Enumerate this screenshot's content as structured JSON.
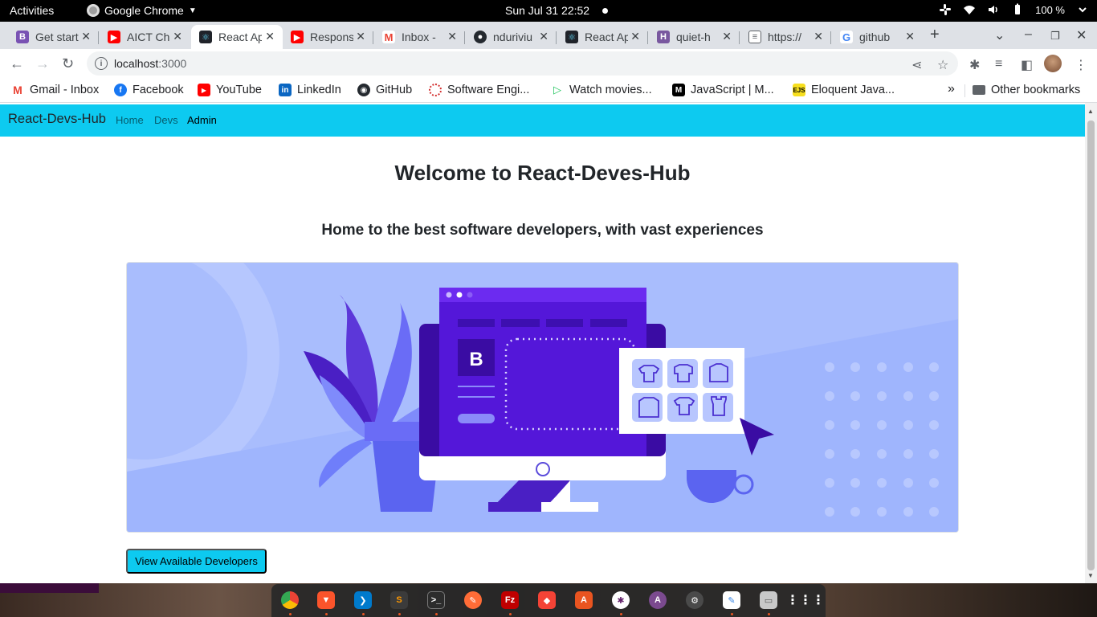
{
  "system": {
    "activities": "Activities",
    "app_name": "Google Chrome",
    "clock": "Sun Jul 31  22:52",
    "battery": "100 %"
  },
  "tabs": [
    {
      "title": "Get started",
      "favicon": "bootstrap-icon",
      "color": "#7952b3"
    },
    {
      "title": "AICT Chan",
      "favicon": "youtube-icon",
      "color": "#ff0000"
    },
    {
      "title": "React App",
      "favicon": "react-icon",
      "color": "#20232a",
      "active": true
    },
    {
      "title": "Responsive",
      "favicon": "youtube-icon",
      "color": "#ff0000"
    },
    {
      "title": "Inbox - ",
      "favicon": "gmail-icon",
      "color": "#ea4335"
    },
    {
      "title": "nduriviu",
      "favicon": "github-icon",
      "color": "#24292f"
    },
    {
      "title": "React App",
      "favicon": "react-icon",
      "color": "#20232a"
    },
    {
      "title": "quiet-h",
      "favicon": "heroku-icon",
      "color": "#79589f"
    },
    {
      "title": "https://",
      "favicon": "page-icon",
      "color": "#5f6368"
    },
    {
      "title": "github",
      "favicon": "google-icon",
      "color": "#4285f4"
    }
  ],
  "omnibox": {
    "host": "localhost",
    "port": ":3000"
  },
  "bookmarks": [
    {
      "label": "Gmail - Inbox",
      "icon": "gmail-icon",
      "color": "#ea4335"
    },
    {
      "label": "Facebook",
      "icon": "facebook-icon",
      "color": "#1877f2"
    },
    {
      "label": "YouTube",
      "icon": "youtube-icon",
      "color": "#ff0000"
    },
    {
      "label": "LinkedIn",
      "icon": "linkedin-icon",
      "color": "#0a66c2"
    },
    {
      "label": "GitHub",
      "icon": "github-icon",
      "color": "#24292f"
    },
    {
      "label": "Software Engi...",
      "icon": "circle-icon",
      "color": "#d32f2f"
    },
    {
      "label": "Watch movies...",
      "icon": "play-icon",
      "color": "#22c55e"
    },
    {
      "label": "JavaScript | M...",
      "icon": "mdn-icon",
      "color": "#000000"
    },
    {
      "label": "Eloquent Java...",
      "icon": "ejs-icon",
      "color": "#f7df1e"
    }
  ],
  "bookmarks_overflow": "»",
  "other_bookmarks": "Other bookmarks",
  "page": {
    "brand": "React-Devs-Hub",
    "nav": [
      {
        "label": "Home"
      },
      {
        "label": "Devs"
      },
      {
        "label": "Admin",
        "active": true
      }
    ],
    "heading": "Welcome to React-Deves-Hub",
    "subheading": "Home to the best software developers, with vast experiences",
    "hero_badge": "B",
    "cta_label": "View Available Developers",
    "accent_color": "#0dcaf0"
  },
  "dock": [
    {
      "icon": "chrome-icon",
      "color": "#4285f4",
      "running": true
    },
    {
      "icon": "brave-icon",
      "color": "#fb542b",
      "running": true
    },
    {
      "icon": "vscode-icon",
      "color": "#007acc",
      "running": true
    },
    {
      "icon": "sublime-icon",
      "color": "#ff9800",
      "running": true
    },
    {
      "icon": "terminal-icon",
      "color": "#2c2c2c",
      "running": true
    },
    {
      "icon": "postman-icon",
      "color": "#ff6c37",
      "running": false
    },
    {
      "icon": "filezilla-icon",
      "color": "#bf0000",
      "running": true
    },
    {
      "icon": "git-client-icon",
      "color": "#f44336",
      "running": false
    },
    {
      "icon": "software-center-icon",
      "color": "#e95420",
      "running": false
    },
    {
      "icon": "slack-icon",
      "color": "#611f69",
      "running": true
    },
    {
      "icon": "app-store-icon",
      "color": "#7b4a8f",
      "running": false
    },
    {
      "icon": "settings-icon",
      "color": "#4a4a4a",
      "running": false
    },
    {
      "icon": "text-editor-icon",
      "color": "#3584e4",
      "running": true
    },
    {
      "icon": "files-icon",
      "color": "#c8c8c8",
      "running": true
    },
    {
      "icon": "show-apps-icon",
      "color": "transparent",
      "running": false
    }
  ]
}
